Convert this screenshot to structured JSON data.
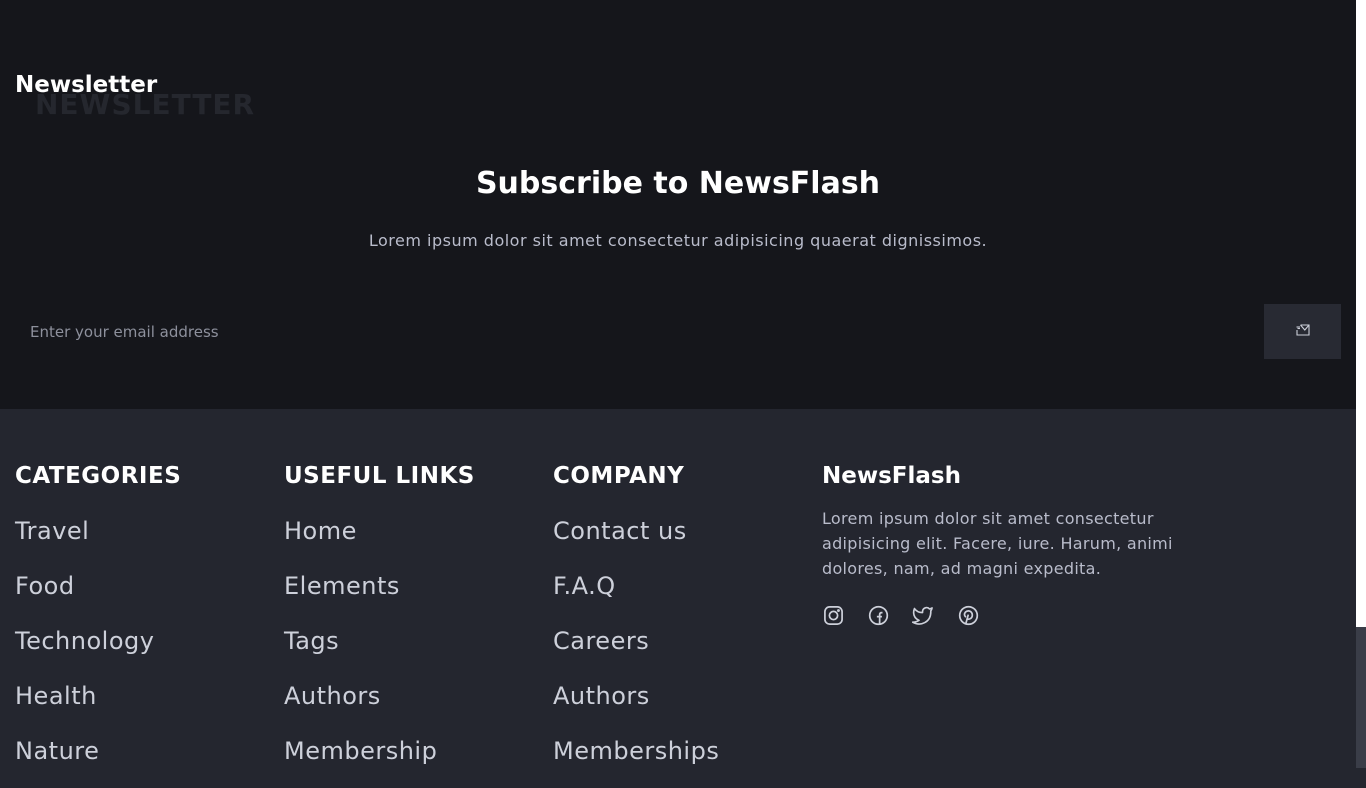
{
  "newsletter": {
    "label": "Newsletter",
    "watermark": "NEWSLETTER",
    "title": "Subscribe to NewsFlash",
    "description": "Lorem ipsum dolor sit amet consectetur adipisicing quaerat dignissimos.",
    "email_placeholder": "Enter your email address",
    "send_icon": "send-mail-icon"
  },
  "footer": {
    "categories": {
      "heading": "CATEGORIES",
      "items": [
        "Travel",
        "Food",
        "Technology",
        "Health",
        "Nature"
      ]
    },
    "useful_links": {
      "heading": "USEFUL LINKS",
      "items": [
        "Home",
        "Elements",
        "Tags",
        "Authors",
        "Membership"
      ]
    },
    "company": {
      "heading": "COMPANY",
      "items": [
        "Contact us",
        "F.A.Q",
        "Careers",
        "Authors",
        "Memberships"
      ]
    },
    "brand": {
      "name": "NewsFlash",
      "description": "Lorem ipsum dolor sit amet consectetur adipisicing elit. Facere, iure. Harum, animi dolores, nam, ad magni expedita.",
      "socials": [
        "instagram-icon",
        "facebook-icon",
        "twitter-icon",
        "pinterest-icon"
      ]
    }
  },
  "colors": {
    "newsletter_bg": "#15161b",
    "footer_bg": "#24262f",
    "heading": "#ffffff",
    "link": "#cdd0da",
    "muted": "#b9bccb",
    "button_bg": "#282a33"
  }
}
